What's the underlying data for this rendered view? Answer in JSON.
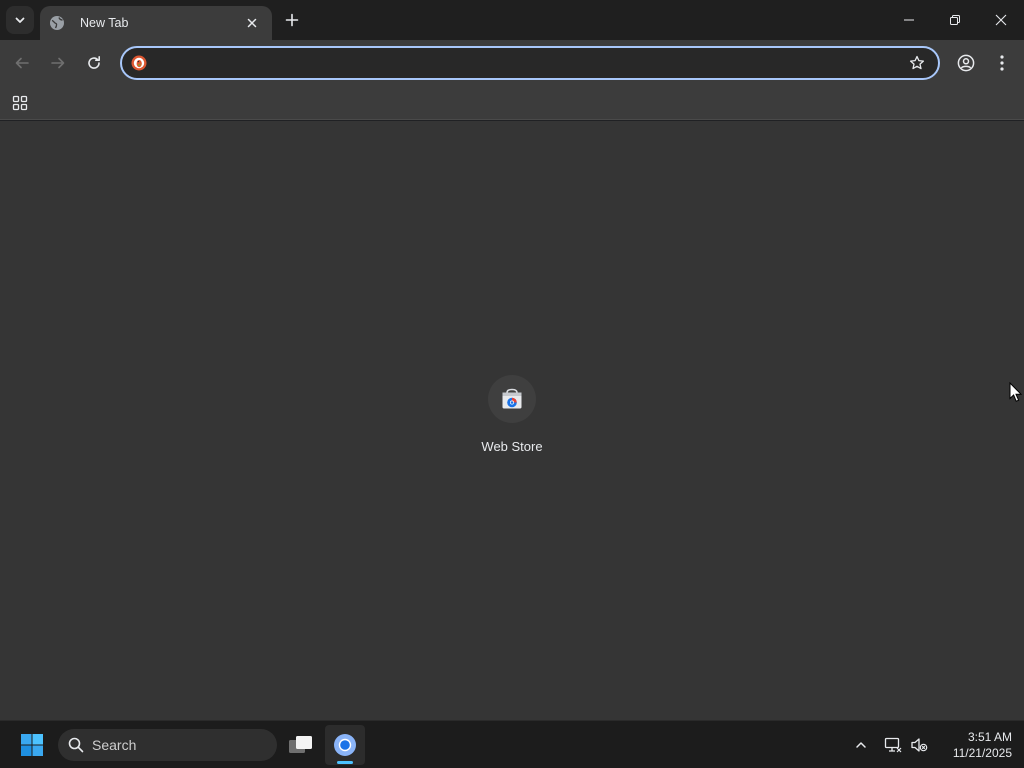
{
  "browser": {
    "tab": {
      "title": "New Tab",
      "favicon": "globe-icon"
    },
    "omnibox": {
      "value": "",
      "placeholder": "",
      "engine_icon": "duckduckgo-icon"
    },
    "icons": {
      "tab_search": "chevron-down-icon",
      "close_tab": "close-icon",
      "new_tab": "plus-icon",
      "back": "arrow-left-icon",
      "forward": "arrow-right-icon",
      "reload": "reload-icon",
      "bookmark": "star-icon",
      "profile": "account-circle-icon",
      "menu": "more-vertical-icon",
      "apps": "apps-grid-icon"
    },
    "colors": {
      "accent": "#a8c7fa",
      "tab_bg": "#3c3c3c",
      "page_bg": "#353535"
    }
  },
  "new_tab_page": {
    "shortcuts": [
      {
        "label": "Web Store",
        "icon": "web-store-icon"
      }
    ]
  },
  "taskbar": {
    "search_label": "Search",
    "apps": [
      {
        "name": "Task View",
        "icon": "task-view-icon"
      },
      {
        "name": "Google Chrome",
        "icon": "chrome-icon",
        "active": true
      }
    ],
    "tray": {
      "chevron": "chevron-up-icon",
      "network": "network-icon",
      "volume": "volume-muted-icon"
    },
    "clock": {
      "time": "3:51 AM",
      "date": "11/21/2025"
    },
    "colors": {
      "active_indicator": "#4cc2ff"
    }
  }
}
